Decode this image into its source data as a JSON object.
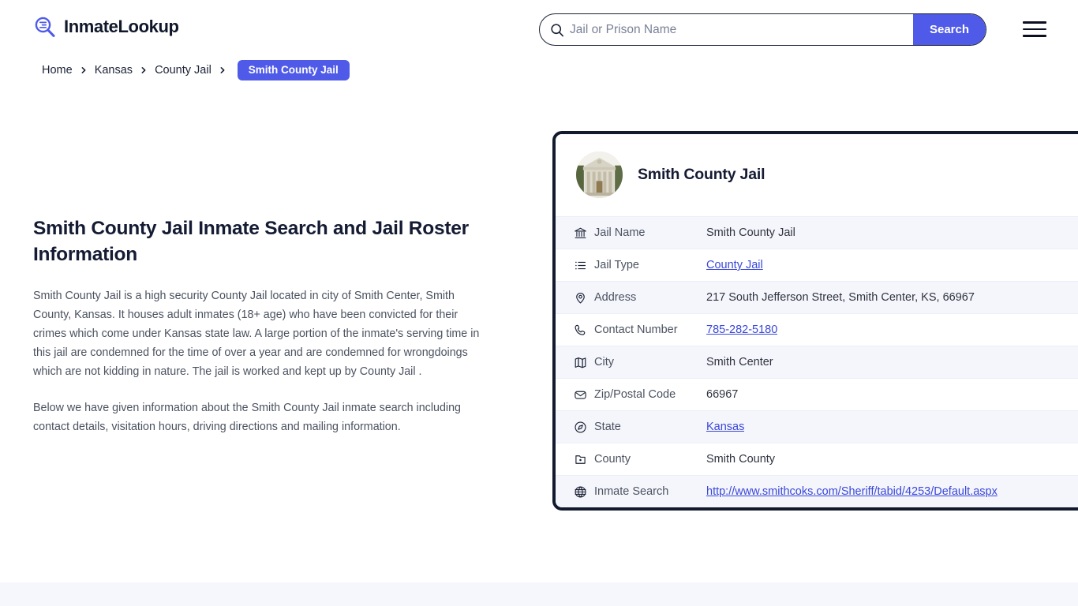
{
  "header": {
    "logo_text": "InmateLookup",
    "logo_icon": "magnifier-list-icon",
    "menu_icon": "hamburger-menu-icon"
  },
  "search": {
    "placeholder": "Jail or Prison Name",
    "value": "",
    "button_label": "Search",
    "icon": "search-icon"
  },
  "breadcrumb": {
    "items": [
      {
        "label": "Home",
        "current": false
      },
      {
        "label": "Kansas",
        "current": false
      },
      {
        "label": "County Jail",
        "current": false
      },
      {
        "label": "Smith County Jail",
        "current": true
      }
    ],
    "separator": "›"
  },
  "main": {
    "title": "Smith County Jail Inmate Search and Jail Roster Information",
    "paragraphs": [
      "Smith County Jail is a high security County Jail located in city of Smith Center, Smith County, Kansas. It houses adult inmates (18+ age) who have been convicted for their crimes which come under Kansas state law. A large portion of the inmate's serving time in this jail are condemned for the time of over a year and are condemned for wrongdoings which are not kidding in nature. The jail is worked and kept up by County Jail .",
      "Below we have given information about the Smith County Jail inmate search including contact details, visitation hours, driving directions and mailing information."
    ]
  },
  "card": {
    "title": "Smith County Jail",
    "photo_icon": "courthouse-photo",
    "rows": [
      {
        "icon": "bank-icon",
        "label": "Jail Name",
        "value": "Smith County Jail",
        "link": false
      },
      {
        "icon": "list-icon",
        "label": "Jail Type",
        "value": "County Jail",
        "link": true
      },
      {
        "icon": "map-pin-icon",
        "label": "Address",
        "value": "217 South Jefferson Street, Smith Center, KS, 66967",
        "link": false
      },
      {
        "icon": "phone-icon",
        "label": "Contact Number",
        "value": "785-282-5180",
        "link": true
      },
      {
        "icon": "map-icon",
        "label": "City",
        "value": "Smith Center",
        "link": false
      },
      {
        "icon": "envelope-icon",
        "label": "Zip/Postal Code",
        "value": "66967",
        "link": false
      },
      {
        "icon": "compass-icon",
        "label": "State",
        "value": "Kansas",
        "link": true
      },
      {
        "icon": "region-icon",
        "label": "County",
        "value": "Smith County",
        "link": false
      },
      {
        "icon": "globe-icon",
        "label": "Inmate Search",
        "value": "http://www.smithcoks.com/Sheriff/tabid/4253/Default.aspx",
        "link": true
      }
    ]
  },
  "colors": {
    "accent_blue": "#4f5ae8",
    "link_blue": "#3a48d8",
    "dark_navy": "#131a2e",
    "row_alt": "#f5f6fc",
    "footer_strip": "#f6f6fd"
  }
}
